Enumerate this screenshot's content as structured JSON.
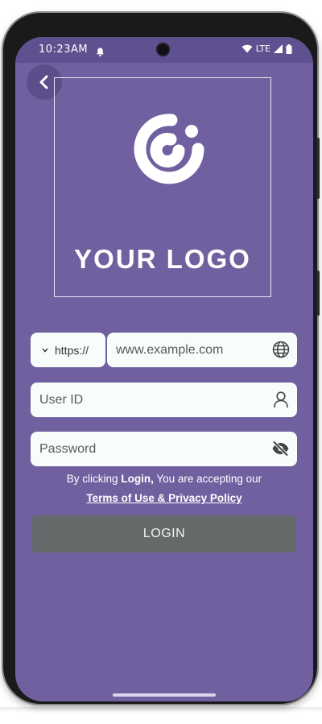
{
  "status_bar": {
    "time": "10:23AM",
    "network": "LTE"
  },
  "logo": {
    "text": "YOUR LOGO"
  },
  "form": {
    "protocol_value": "https://",
    "url_placeholder": "www.example.com",
    "user_placeholder": "User ID",
    "password_placeholder": "Password"
  },
  "terms": {
    "prefix": "By clicking ",
    "bold": "Login,",
    "suffix": " You are accepting our",
    "link": "Terms of Use & Privacy Policy"
  },
  "login_button": {
    "label": "LOGIN"
  },
  "colors": {
    "background": "#7060a0",
    "status_bar": "#5f5090",
    "field": "#f7fdfa",
    "button": "#636a69"
  }
}
